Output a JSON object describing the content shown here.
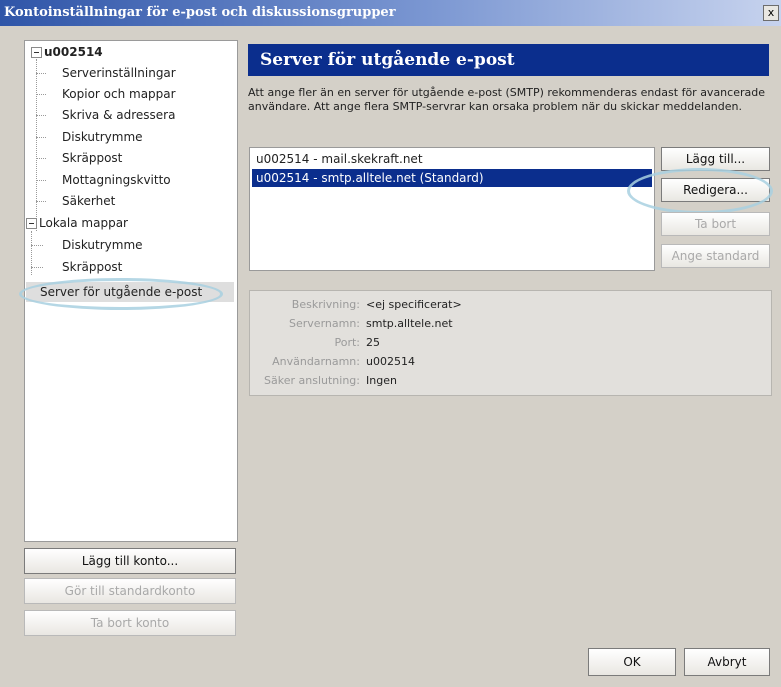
{
  "window": {
    "title": "Kontoinställningar för e-post och diskussionsgrupper",
    "close_glyph": "x"
  },
  "tree": {
    "account": "u002514",
    "account_items": [
      "Serverinställningar",
      "Kopior och mappar",
      "Skriva & adressera",
      "Diskutrymme",
      "Skräppost",
      "Mottagningskvitto",
      "Säkerhet"
    ],
    "local": "Lokala mappar",
    "local_items": [
      "Diskutrymme",
      "Skräppost"
    ],
    "outgoing": "Server för utgående e-post"
  },
  "left_buttons": {
    "add_account": "Lägg till konto...",
    "make_default": "Gör till standardkonto",
    "remove_account": "Ta bort konto"
  },
  "panel": {
    "header": "Server för utgående e-post",
    "description": "Att ange fler än en server för utgående e-post (SMTP) rekommenderas endast för avancerade användare. Att ange flera SMTP-servrar kan orsaka problem när du skickar meddelanden.",
    "servers": [
      "u002514 - mail.skekraft.net",
      "u002514 - smtp.alltele.net (Standard)"
    ],
    "buttons": {
      "add": "Lägg till...",
      "edit": "Redigera...",
      "remove": "Ta bort",
      "set_default": "Ange standard"
    },
    "details": {
      "labels": [
        "Beskrivning:",
        "Servernamn:",
        "Port:",
        "Användarnamn:",
        "Säker anslutning:"
      ],
      "values": [
        "<ej specificerat>",
        "smtp.alltele.net",
        "25",
        "u002514",
        "Ingen"
      ]
    }
  },
  "footer": {
    "ok": "OK",
    "cancel": "Avbryt"
  },
  "colors": {
    "selection": "#0b2e8d",
    "highlight": "#a8d0e0"
  }
}
